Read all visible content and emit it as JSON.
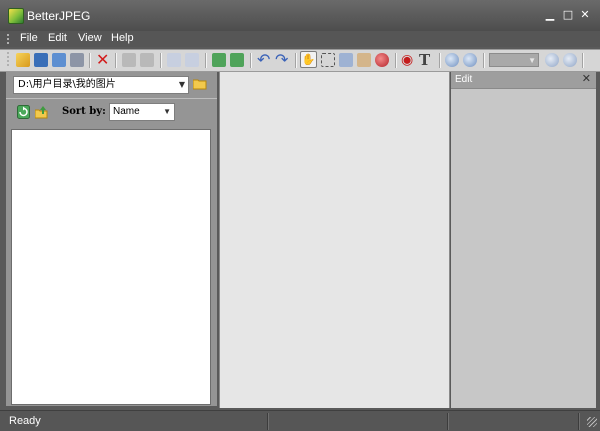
{
  "window": {
    "title": "BetterJPEG"
  },
  "title_controls": [
    "minimize",
    "maximize",
    "close"
  ],
  "menu": {
    "items": [
      "File",
      "Edit",
      "View",
      "Help"
    ]
  },
  "toolbar": {
    "zoom_value": "",
    "buttons": [
      {
        "icon": "open-icon"
      },
      {
        "icon": "save-icon"
      },
      {
        "icon": "save-as-icon"
      },
      {
        "icon": "print-icon"
      },
      {
        "icon": "delete-icon"
      },
      {
        "icon": "prev-image-icon"
      },
      {
        "icon": "next-image-icon"
      },
      {
        "icon": "copy-icon"
      },
      {
        "icon": "paste-icon"
      },
      {
        "icon": "rotate-left-icon"
      },
      {
        "icon": "rotate-right-icon"
      },
      {
        "icon": "undo-icon"
      },
      {
        "icon": "redo-icon"
      },
      {
        "icon": "hand-icon"
      },
      {
        "icon": "select-rect-icon"
      },
      {
        "icon": "crop-icon"
      },
      {
        "icon": "patch-icon"
      },
      {
        "icon": "color-icon"
      },
      {
        "icon": "red-eye-icon"
      },
      {
        "icon": "text-icon"
      },
      {
        "icon": "zoom-in-icon"
      },
      {
        "icon": "zoom-out-icon"
      },
      {
        "icon": "zoom-fit-icon"
      },
      {
        "icon": "zoom-actual-icon"
      }
    ]
  },
  "browser": {
    "path": "D:\\用户目录\\我的图片",
    "sort_label": "Sort by:",
    "sort_value": "Name"
  },
  "edit_panel": {
    "title": "Edit"
  },
  "status": {
    "text": "Ready"
  },
  "colors": {
    "chrome_dark": "#565656",
    "toolbar_bg": "#d6d6d6",
    "canvas_bg": "#e6e6e6",
    "edit_panel_bg": "#c7c7c7"
  }
}
